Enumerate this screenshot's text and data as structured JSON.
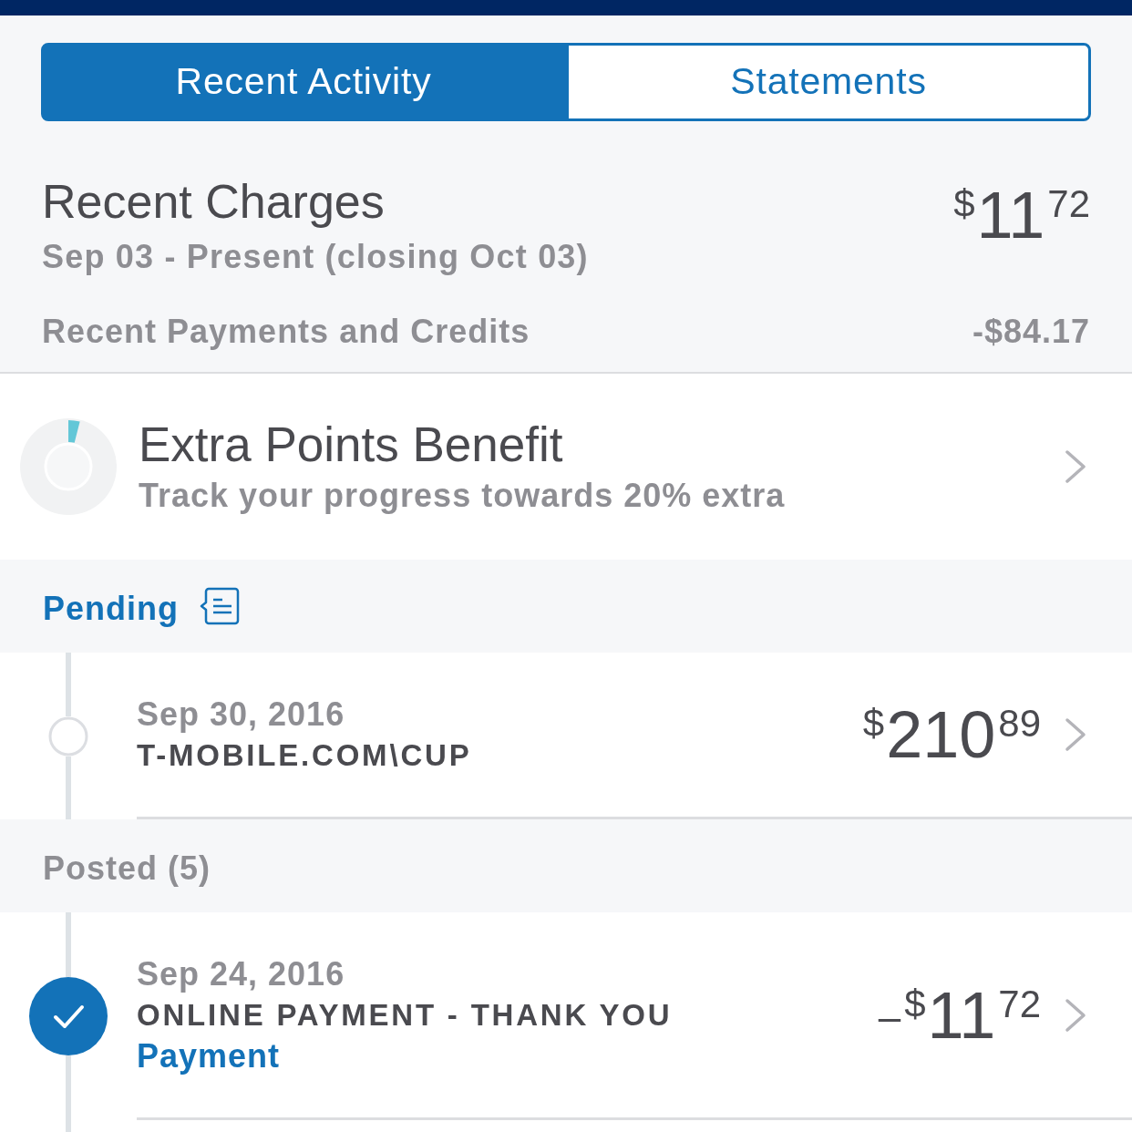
{
  "tabs": [
    {
      "label": "Recent Activity",
      "selected": true
    },
    {
      "label": "Statements",
      "selected": false
    }
  ],
  "summary": {
    "title": "Recent Charges",
    "period": "Sep 03 - Present (closing Oct 03)",
    "total": {
      "currency": "$",
      "whole": "11",
      "cents": "72"
    },
    "payments_label": "Recent Payments and Credits",
    "payments_amount": "-$84.17"
  },
  "benefit": {
    "title": "Extra Points Benefit",
    "subtitle": "Track your progress towards 20% extra",
    "level": 0.04
  },
  "sections": [
    {
      "kind": "pending",
      "title": "Pending",
      "transactions": [
        {
          "date": "Sep 30, 2016",
          "merchant": "T-MOBILE.COM\\CUP",
          "amount": {
            "currency": "$",
            "whole": "210",
            "cents": "89"
          },
          "checked": false
        }
      ]
    },
    {
      "kind": "posted",
      "title": "Posted (5)",
      "transactions": [
        {
          "date": "Sep 24, 2016",
          "merchant": "ONLINE PAYMENT - THANK YOU",
          "category": "Payment",
          "amount": {
            "sign": "–",
            "currency": "$",
            "whole": "11",
            "cents": "72"
          },
          "checked": true
        }
      ]
    }
  ]
}
